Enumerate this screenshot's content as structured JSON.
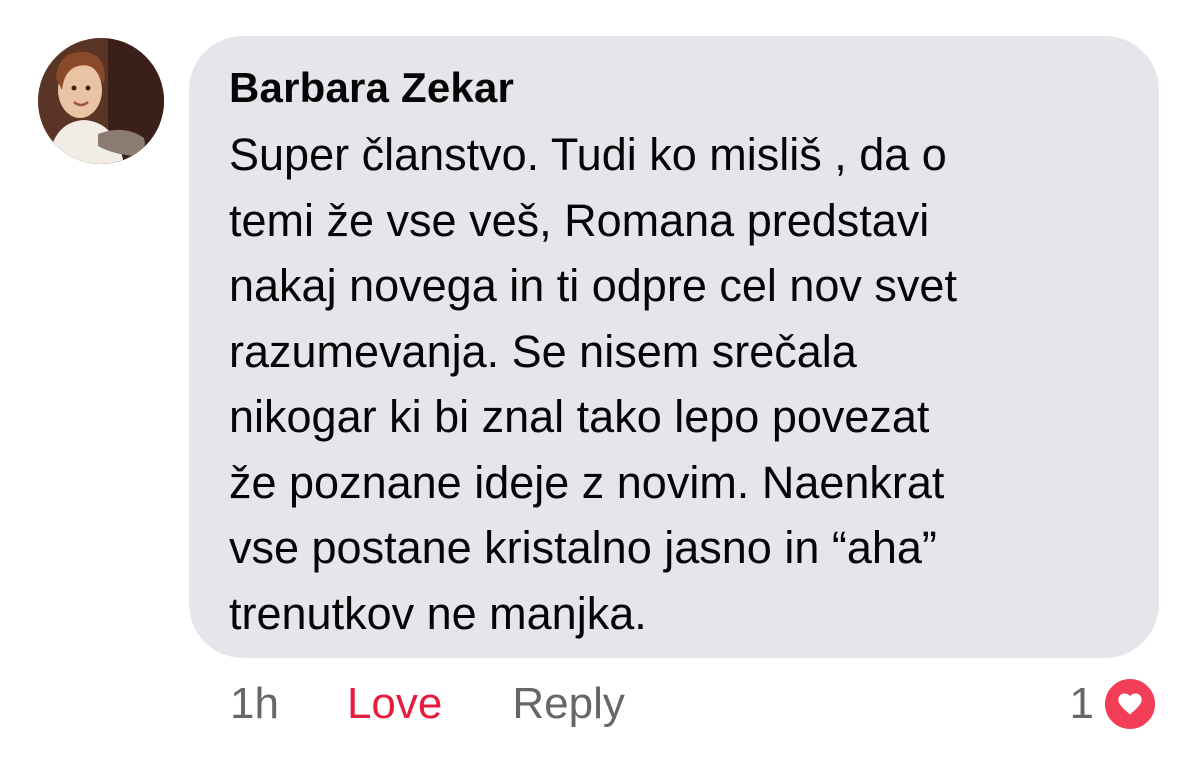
{
  "comment": {
    "author": "Barbara Zekar",
    "text": "Super članstvo. Tudi ko misliš , da o\ntemi že vse veš, Romana predstavi\nnakaj novega in ti odpre cel nov svet\nrazumevanja. Se nisem srečala\nnikogar ki bi znal tako lepo povezat\nže poznane ideje z novim. Naenkrat\nvse postane kristalno jasno in “aha”\ntrenutkov ne manjka.",
    "avatar_icon": "profile-photo"
  },
  "actions": {
    "time": "1h",
    "love_label": "Love",
    "reply_label": "Reply"
  },
  "reactions": {
    "count": "1",
    "icon": "heart-icon"
  },
  "colors": {
    "bubble": "#e4e6eb",
    "love_active": "#e41e3f",
    "heart_badge": "#f33e58",
    "secondary_text": "#65676b"
  }
}
